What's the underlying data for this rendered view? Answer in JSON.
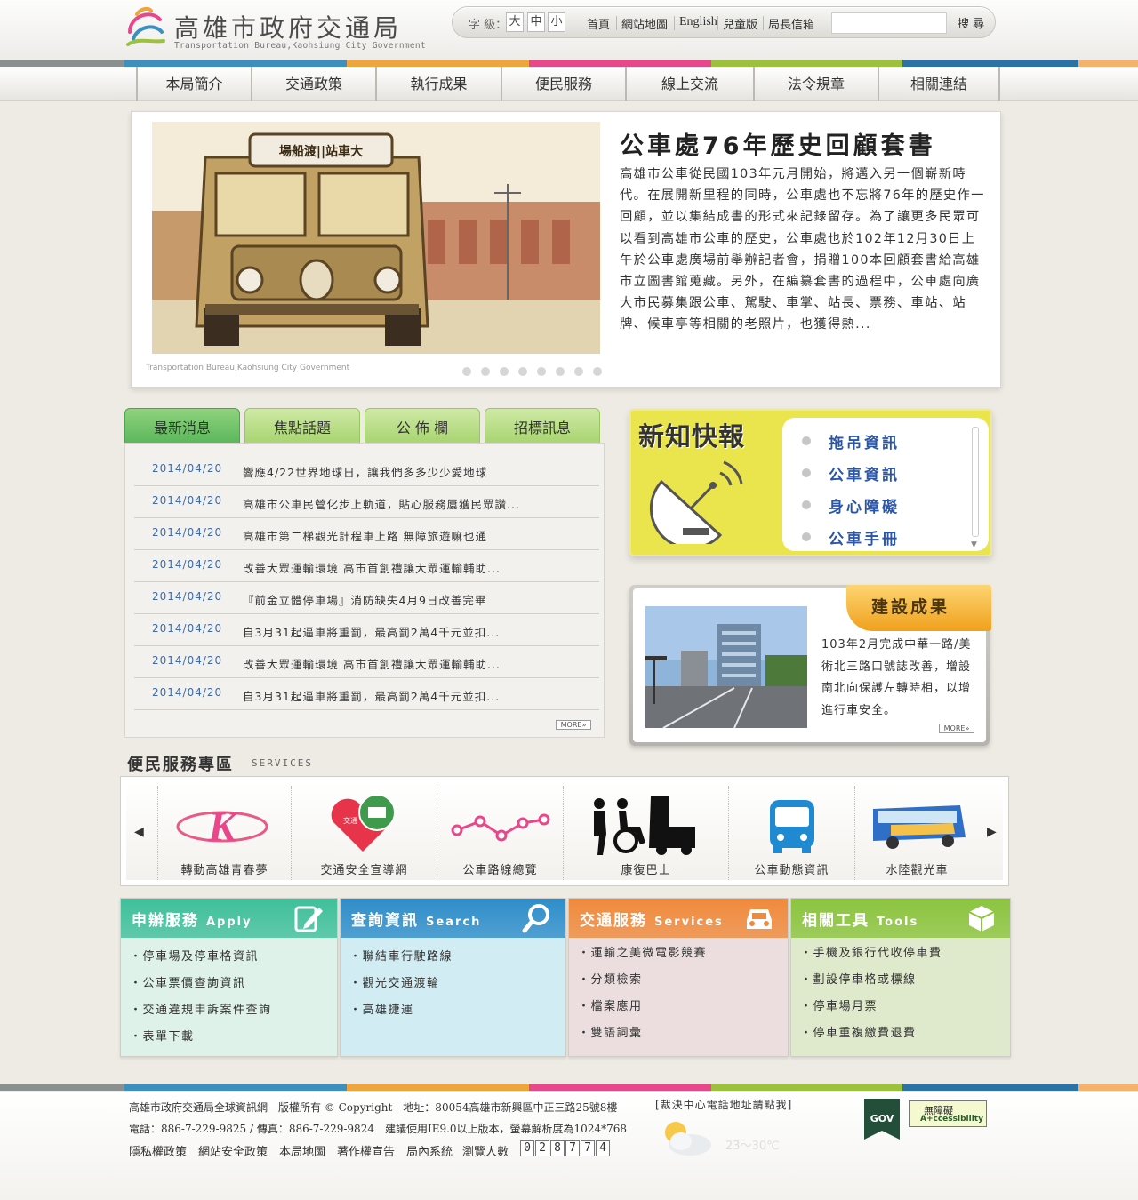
{
  "header": {
    "title": "高雄市政府交通局",
    "subtitle": "Transportation Bureau,Kaohsiung City Government",
    "font_size_label": "字 級：",
    "font_sizes": [
      "大",
      "中",
      "小"
    ],
    "links": [
      "首頁",
      "網站地圖",
      "English",
      "兒童版",
      "局長信箱"
    ],
    "search_placeholder": "",
    "search_button": "搜 尋"
  },
  "nav": [
    "本局簡介",
    "交通政策",
    "執行成果",
    "便民服務",
    "線上交流",
    "法令規章",
    "相關連結"
  ],
  "feature": {
    "title": "公車處76年歷史回顧套書",
    "body": "高雄市公車從民國103年元月開始，將邁入另一個嶄新時代。在展開新里程的同時，公車處也不忘將76年的歷史作一回顧，並以集結成書的形式來記錄留存。為了讓更多民眾可以看到高雄市公車的歷史，公車處也於102年12月30日上午於公車處廣場前舉辦記者會，捐贈100本回顧套書給高雄市立圖書館蒐藏。另外，在編纂套書的過程中，公車處向廣大市民募集跟公車、駕駛、車掌、站長、票務、車站、站牌、候車亭等相關的老照片，也獲得熱...",
    "caption": "Transportation Bureau,Kaohsiung City Government",
    "bus_sign": "場船渡||站車大",
    "slide_count": 8
  },
  "news": {
    "tabs": [
      "最新消息",
      "焦點話題",
      "公 佈 欄",
      "招標訊息"
    ],
    "items": [
      {
        "date": "2014/04/20",
        "title": "響應4/22世界地球日，讓我們多多少少愛地球"
      },
      {
        "date": "2014/04/20",
        "title": "高雄市公車民營化步上軌道，貼心服務屢獲民眾讚..."
      },
      {
        "date": "2014/04/20",
        "title": "高雄市第二梯觀光計程車上路 無障旅遊嘛也通"
      },
      {
        "date": "2014/04/20",
        "title": "改善大眾運輸環境 高市首創禮讓大眾運輸輔助..."
      },
      {
        "date": "2014/04/20",
        "title": "『前金立體停車場』消防缺失4月9日改善完畢"
      },
      {
        "date": "2014/04/20",
        "title": "自3月31起逼車將重罰，最高罰2萬4千元並扣..."
      },
      {
        "date": "2014/04/20",
        "title": "改善大眾運輸環境 高市首創禮讓大眾運輸輔助..."
      },
      {
        "date": "2014/04/20",
        "title": "自3月31起逼車將重罰，最高罰2萬4千元並扣..."
      }
    ],
    "more": "MORE»"
  },
  "quick": {
    "title": "新知快報",
    "items": [
      "拖吊資訊",
      "公車資訊",
      "身心障礙",
      "公車手冊"
    ]
  },
  "build": {
    "title": "建設成果",
    "text": "103年2月完成中華一路/美術北三路口號誌改善，增設南北向保護左轉時相，以增進行車安全。",
    "more": "MORE»"
  },
  "services": {
    "heading": "便民服務專區",
    "heading_en": "SERVICES",
    "items": [
      "轉動高雄青春夢",
      "交通安全宣導網",
      "公車路線總覽",
      "康復巴士",
      "公車動態資訊",
      "水陸觀光車"
    ],
    "prev": "◀",
    "next": "▶"
  },
  "boxes": [
    {
      "title": "申辦服務",
      "title_en": "Apply",
      "head_color": "#3fbf9a",
      "bg": "#dff2ea",
      "items": [
        "停車場及停車格資訊",
        "公車票價查詢資訊",
        "交通違規申訴案件查詢",
        "表單下載"
      ]
    },
    {
      "title": "查詢資訊",
      "title_en": "Search",
      "head_color": "#2f8dc9",
      "bg": "#d2ecf3",
      "items": [
        "聯結車行駛路線",
        "觀光交通渡輪",
        "高雄捷運"
      ]
    },
    {
      "title": "交通服務",
      "title_en": "Services",
      "head_color": "#f08a3c",
      "bg": "#ecdede",
      "items": [
        "運輸之美微電影競賽",
        "分類檢索",
        "檔案應用",
        "雙語詞彙"
      ]
    },
    {
      "title": "相關工具",
      "title_en": "Tools",
      "head_color": "#8cc43f",
      "bg": "#dfe9cc",
      "items": [
        "手機及銀行代收停車費",
        "劃設停車格或標線",
        "停車場月票",
        "停車重複繳費退費"
      ]
    }
  ],
  "footer": {
    "line1": "高雄市政府交通局全球資訊網　版權所有 © Copyright　地址：80054高雄市新興區中正三路25號8樓",
    "line2": "電話：886-7-229-9825 / 傳真：886-7-229-9824　建議使用IE9.0以上版本，螢幕解析度為1024*768",
    "links": [
      "隱私權政策",
      "網站安全政策",
      "本局地圖",
      "著作權宣告",
      "局內系統",
      "瀏覽人數"
    ],
    "counter": [
      "0",
      "2",
      "8",
      "7",
      "7",
      "4"
    ],
    "ruling": "[裁決中心電話地址請點我]",
    "weather": "23～30℃",
    "gov_label": "GOV",
    "accessibility_label": "無障礙",
    "accessibility_sub": "A+ccessibility"
  },
  "colors": {
    "stripe": [
      "#8a8f8f",
      "#3c8fbf",
      "#f0a43c",
      "#e8478a",
      "#9cc13c",
      "#2b72a8",
      "#f6b26b"
    ],
    "link_blue": "#2b55a6",
    "news_date": "#3d6aa8"
  }
}
